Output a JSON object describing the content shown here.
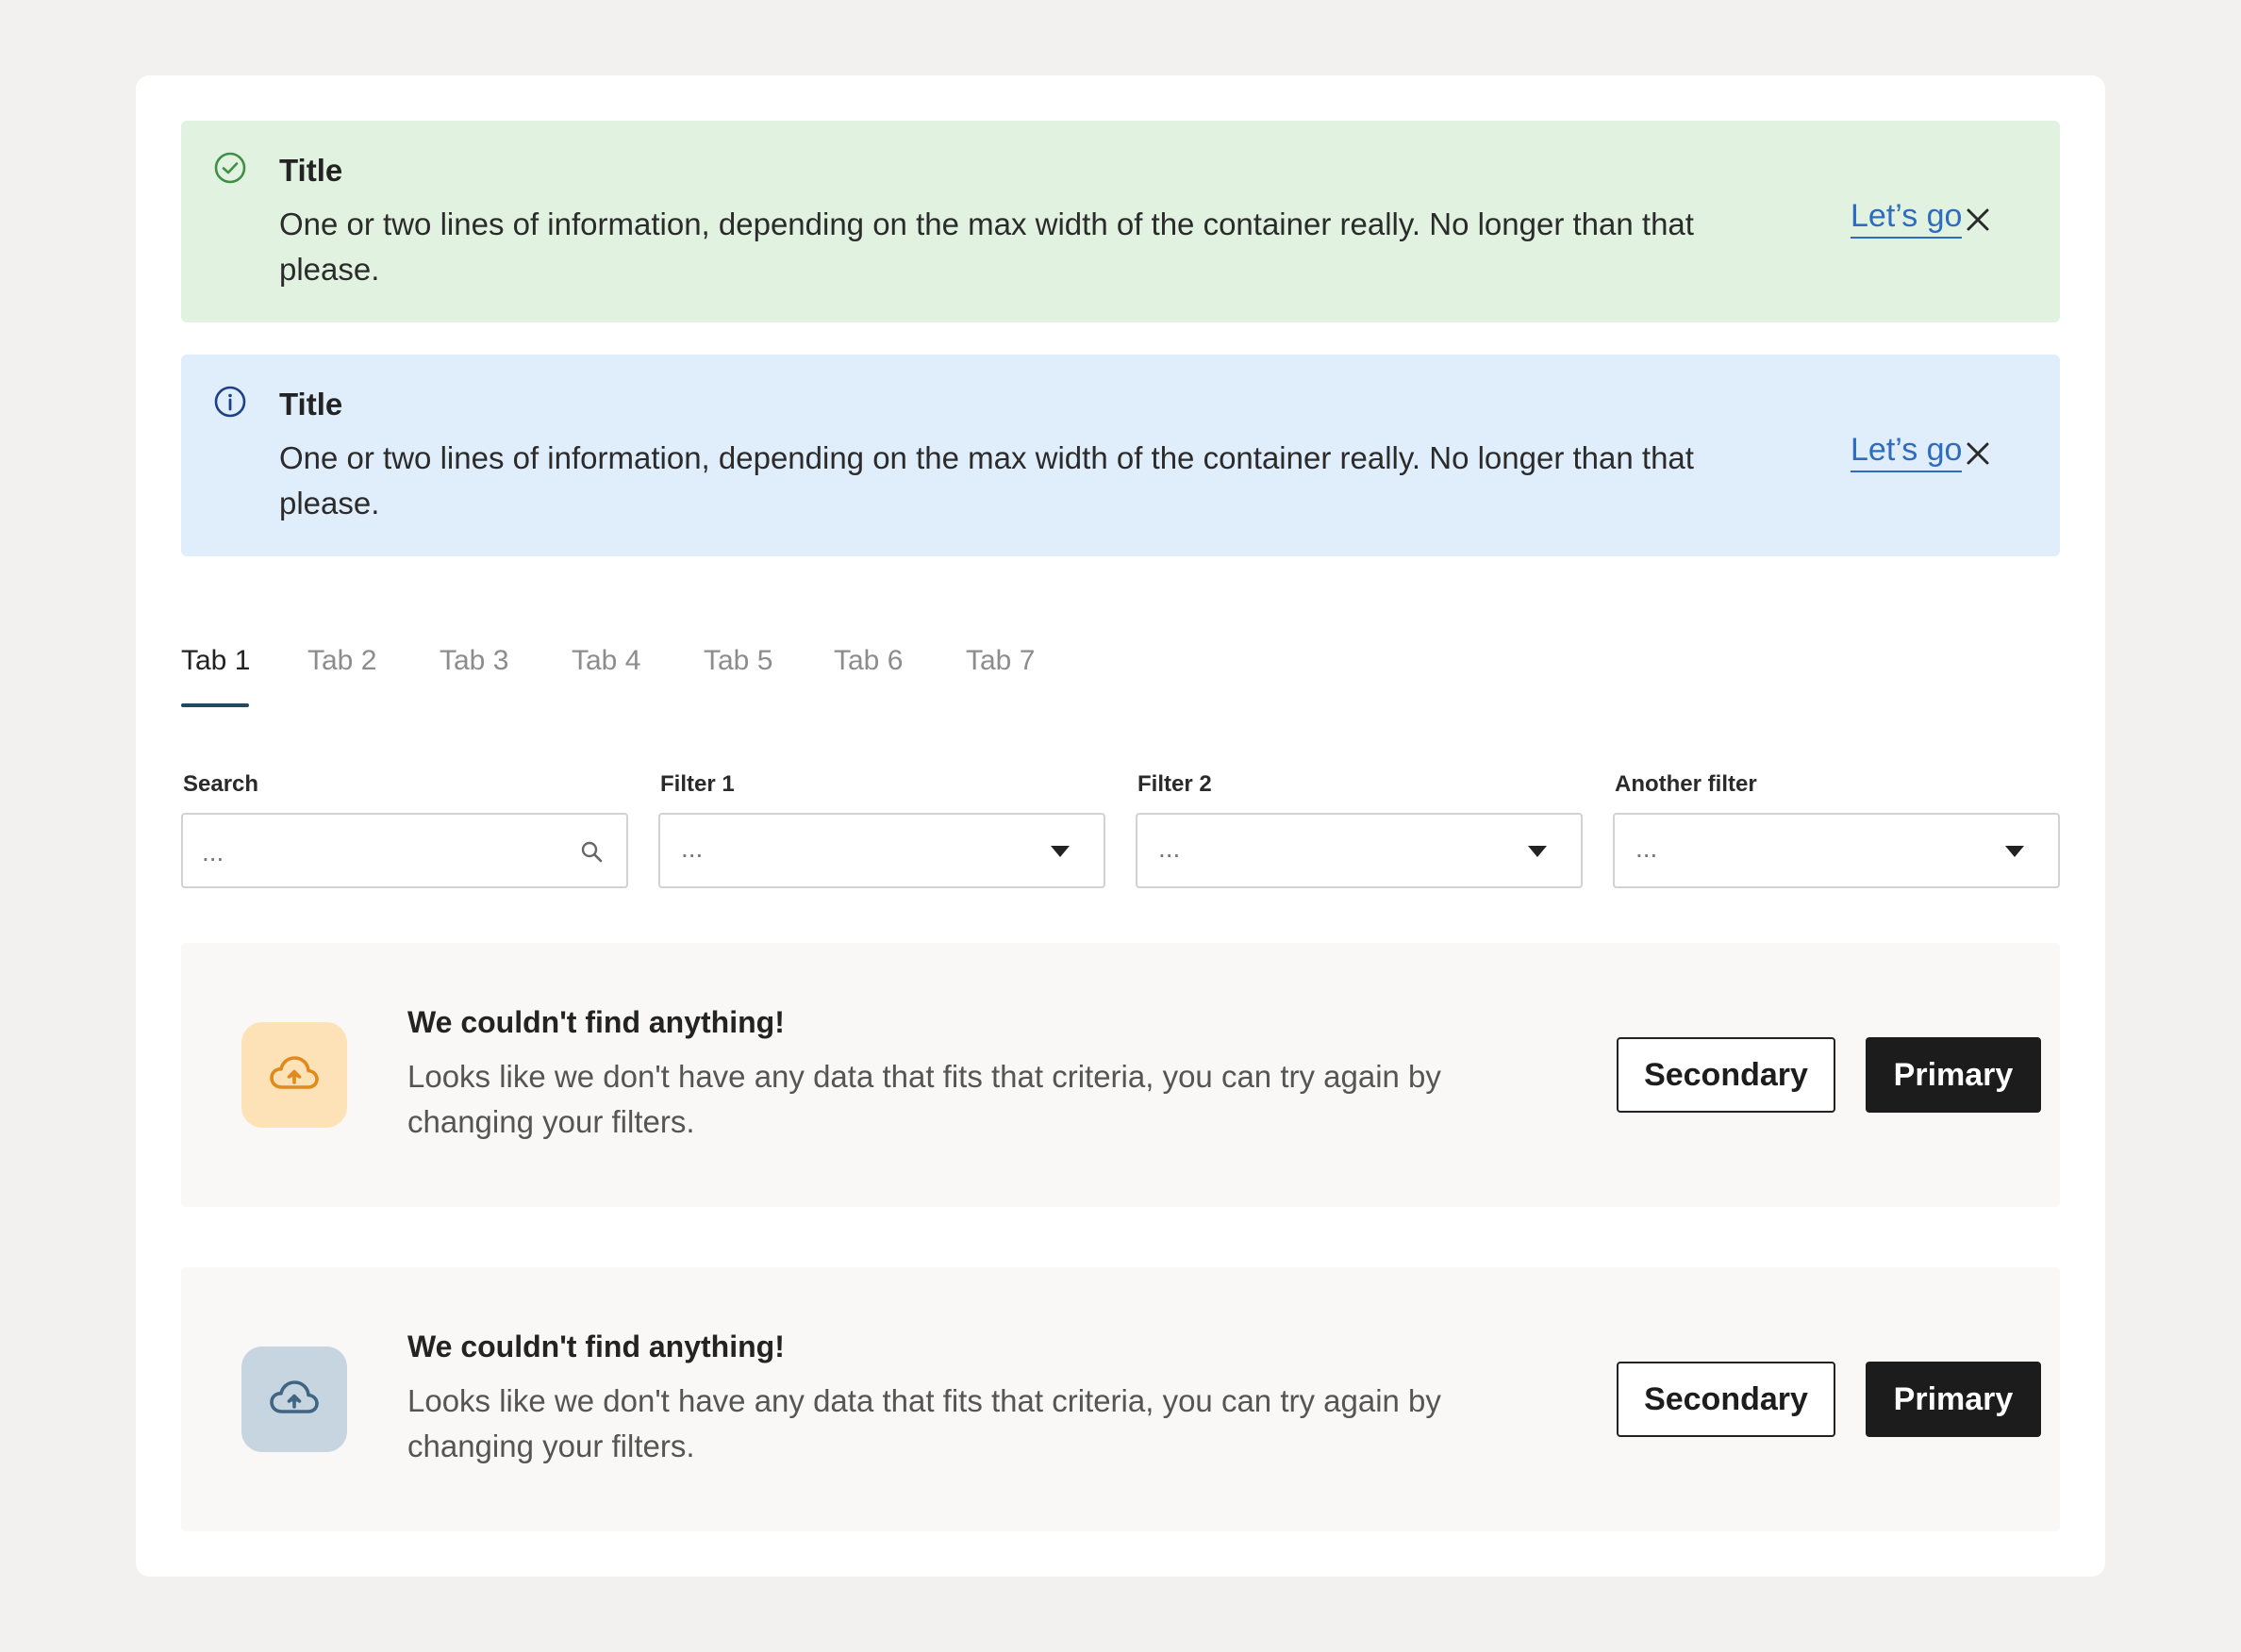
{
  "colors": {
    "page_bg": "#f2f1ef",
    "success_bg": "#e1f2e0",
    "success_icon": "#3f8f45",
    "info_bg": "#e0edfb",
    "info_icon": "#1c3f8a",
    "link": "#2d6cc0",
    "tab_active_underline": "#1f4a5f",
    "empty_icon_orange_bg": "#fde2b8",
    "empty_icon_orange": "#e08a1e",
    "empty_icon_blue_bg": "#c7d5e0",
    "empty_icon_blue": "#3f6583",
    "primary_button": "#1c1c1c"
  },
  "alerts": [
    {
      "variant": "success",
      "icon": "check-circle-icon",
      "title": "Title",
      "body": "One or two lines of information, depending on the max width of the container really. No longer than that please.",
      "link_label": "Let’s go",
      "close_icon": "close-icon"
    },
    {
      "variant": "info",
      "icon": "info-circle-icon",
      "title": "Title",
      "body": "One or two lines of information, depending on the max width of the container really. No longer than that please.",
      "link_label": "Let’s go",
      "close_icon": "close-icon"
    }
  ],
  "tabs": {
    "active_index": 0,
    "items": [
      {
        "label": "Tab 1"
      },
      {
        "label": "Tab 2"
      },
      {
        "label": "Tab 3"
      },
      {
        "label": "Tab 4"
      },
      {
        "label": "Tab 5"
      },
      {
        "label": "Tab 6"
      },
      {
        "label": "Tab 7"
      }
    ]
  },
  "filters": {
    "search": {
      "label": "Search",
      "placeholder": "...",
      "icon": "search-icon"
    },
    "filter1": {
      "label": "Filter 1",
      "value": "...",
      "icon": "chevron-down-icon"
    },
    "filter2": {
      "label": "Filter 2",
      "value": "...",
      "icon": "chevron-down-icon"
    },
    "another": {
      "label": "Another filter",
      "value": "...",
      "icon": "chevron-down-icon"
    }
  },
  "empty_states": [
    {
      "icon": "cloud-upload-icon",
      "title": "We couldn't find anything!",
      "body": "Looks like we don't have any data that fits that criteria, you can try again by changing your filters.",
      "secondary_label": "Secondary",
      "primary_label": "Primary"
    },
    {
      "icon": "cloud-upload-icon",
      "title": "We couldn't find anything!",
      "body": "Looks like we don't have any data that fits that criteria, you can try again by changing your filters.",
      "secondary_label": "Secondary",
      "primary_label": "Primary"
    }
  ]
}
